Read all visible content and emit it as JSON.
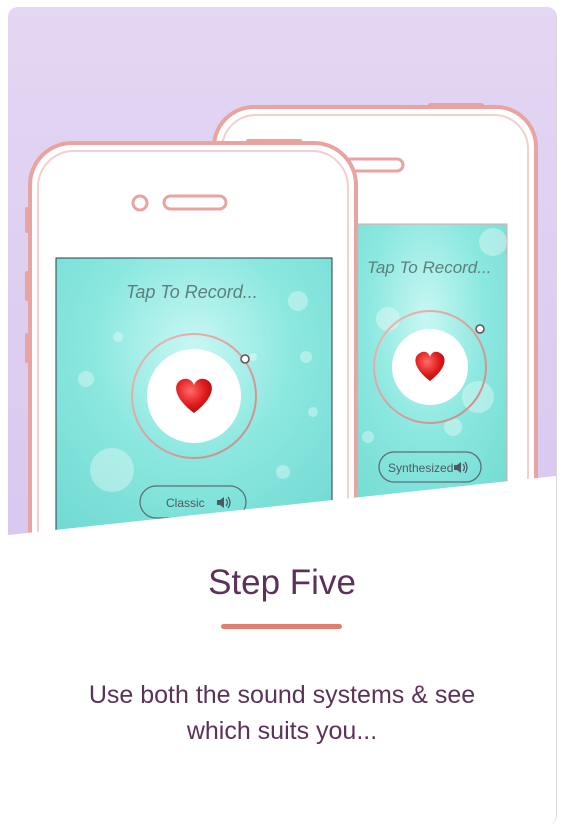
{
  "hero": {
    "front_phone": {
      "prompt": "Tap To Record...",
      "mode_label": "Classic",
      "icon": "heart-icon",
      "speaker_icon": "speaker-icon"
    },
    "back_phone": {
      "prompt": "Tap To Record...",
      "mode_label": "Synthesized",
      "icon": "heart-icon",
      "speaker_icon": "speaker-icon"
    }
  },
  "step": {
    "title": "Step Five",
    "description_line1": "Use both the sound systems & see",
    "description_line2": "which suits you..."
  },
  "colors": {
    "hero_bg": "#dccdf1",
    "screen": "#7fe3dc",
    "phone_frame": "#e9a3a0",
    "title": "#5b3358",
    "accent": "#e07f72"
  }
}
